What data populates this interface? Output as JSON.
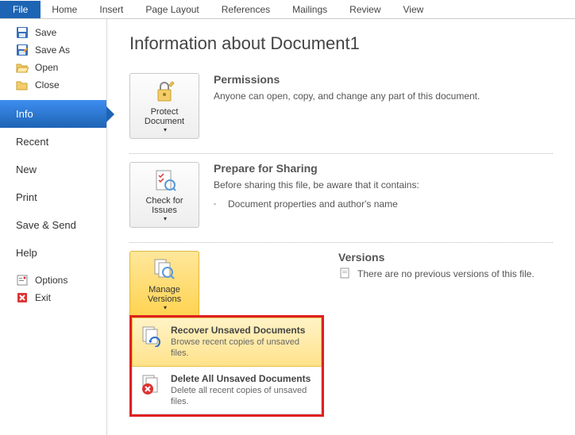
{
  "ribbon": {
    "tabs": [
      "File",
      "Home",
      "Insert",
      "Page Layout",
      "References",
      "Mailings",
      "Review",
      "View"
    ]
  },
  "nav": {
    "top": [
      {
        "icon": "save",
        "label": "Save"
      },
      {
        "icon": "saveas",
        "label": "Save As"
      },
      {
        "icon": "open",
        "label": "Open"
      },
      {
        "icon": "close",
        "label": "Close"
      }
    ],
    "mid": [
      "Info",
      "Recent",
      "New",
      "Print",
      "Save & Send",
      "Help"
    ],
    "bottom": [
      {
        "icon": "options",
        "label": "Options"
      },
      {
        "icon": "exit",
        "label": "Exit"
      }
    ],
    "selected": "Info"
  },
  "page": {
    "title": "Information about Document1"
  },
  "sections": {
    "permissions": {
      "button": "Protect\nDocument",
      "title": "Permissions",
      "text": "Anyone can open, copy, and change any part of this document."
    },
    "sharing": {
      "button": "Check for\nIssues",
      "title": "Prepare for Sharing",
      "text": "Before sharing this file, be aware that it contains:",
      "item": "Document properties and author's name"
    },
    "versions": {
      "button": "Manage\nVersions",
      "title": "Versions",
      "text": "There are no previous versions of this file."
    }
  },
  "dropdown": {
    "recover": {
      "title": "Recover Unsaved Documents",
      "sub": "Browse recent copies of unsaved files."
    },
    "delete": {
      "title": "Delete All Unsaved Documents",
      "sub": "Delete all recent copies of unsaved files."
    }
  }
}
